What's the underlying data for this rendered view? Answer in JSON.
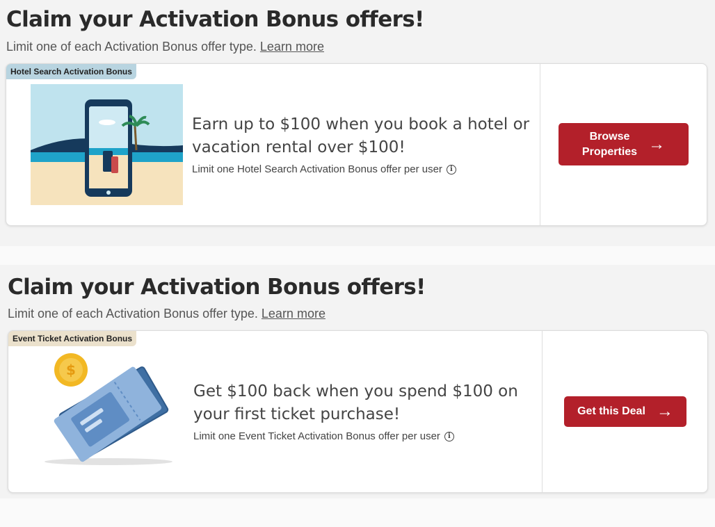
{
  "offers": [
    {
      "heading": "Claim your Activation Bonus offers!",
      "subtext": "Limit one of each Activation Bonus offer type.",
      "learn_more": "Learn more",
      "badge": "Hotel Search Activation Bonus",
      "title": "Earn up to $100 when you book a hotel or vacation rental over $100!",
      "limit": "Limit one Hotel Search Activation Bonus offer per user",
      "cta_line1": "Browse",
      "cta_line2": "Properties",
      "illustration_icon": "phone-beach-icon"
    },
    {
      "heading": "Claim your Activation Bonus offers!",
      "subtext": "Limit one of each Activation Bonus offer type.",
      "learn_more": "Learn more",
      "badge": "Event Ticket Activation Bonus",
      "title": "Get $100 back when you spend $100 on your first ticket purchase!",
      "limit": "Limit one Event Ticket Activation Bonus offer per user",
      "cta_label": "Get this Deal",
      "illustration_icon": "ticket-coin-icon"
    }
  ],
  "colors": {
    "cta": "#b3202a",
    "hotel_badge": "#b8d4e0",
    "ticket_badge": "#ebe1cc"
  },
  "icons": [
    "info-icon",
    "arrow-right-icon"
  ]
}
